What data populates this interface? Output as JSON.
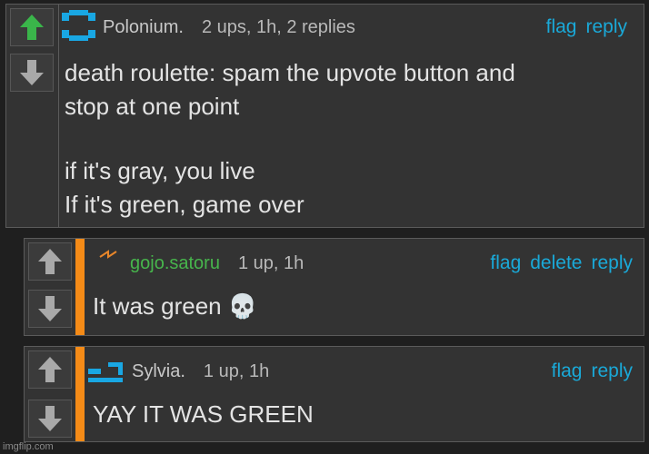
{
  "comments": [
    {
      "username": "Polonium.",
      "meta": "2 ups, 1h, 2 replies",
      "actions": [
        "flag",
        "reply"
      ],
      "lines": [
        "death roulette: spam the upvote button and",
        "stop at one point",
        "",
        "if it's gray, you live",
        "If it's green, game over"
      ],
      "upvoted": true
    },
    {
      "username": "gojo.satoru",
      "meta": "1 up, 1h",
      "actions": [
        "flag",
        "delete",
        "reply"
      ],
      "lines": [
        "It was green 💀"
      ],
      "upvoted": false
    },
    {
      "username": "Sylvia.",
      "meta": "1 up, 1h",
      "actions": [
        "flag",
        "reply"
      ],
      "lines": [
        "YAY IT WAS GREEN"
      ],
      "upvoted": false
    }
  ],
  "colors": {
    "upvote_active": "#3ab54a",
    "vote_inactive": "#a9a9a9",
    "link": "#1aa9d8",
    "username_green": "#47b54c",
    "accent_orange": "#f58b17"
  },
  "watermark": "imgflip.com"
}
